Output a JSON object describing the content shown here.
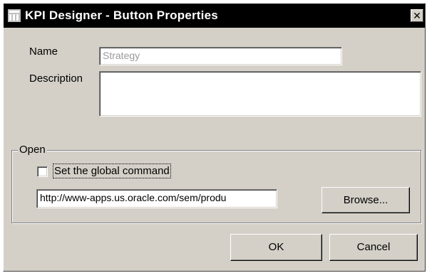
{
  "window": {
    "title": "KPI Designer - Button Properties",
    "close_glyph": "✕",
    "icon": "kpi-designer-app-icon"
  },
  "form": {
    "name_label": "Name",
    "name_value": "Strategy",
    "description_label": "Description",
    "description_value": ""
  },
  "open_group": {
    "legend": "Open",
    "checkbox_label": "Set the global command",
    "checkbox_checked": false,
    "url_value": "http://www-apps.us.oracle.com/sem/produ",
    "browse_label": "Browse..."
  },
  "buttons": {
    "ok_label": "OK",
    "cancel_label": "Cancel"
  },
  "colors": {
    "dialog_bg": "#d4d0c8",
    "titlebar_bg": "#000000",
    "disabled_text": "#9a9a9a"
  }
}
